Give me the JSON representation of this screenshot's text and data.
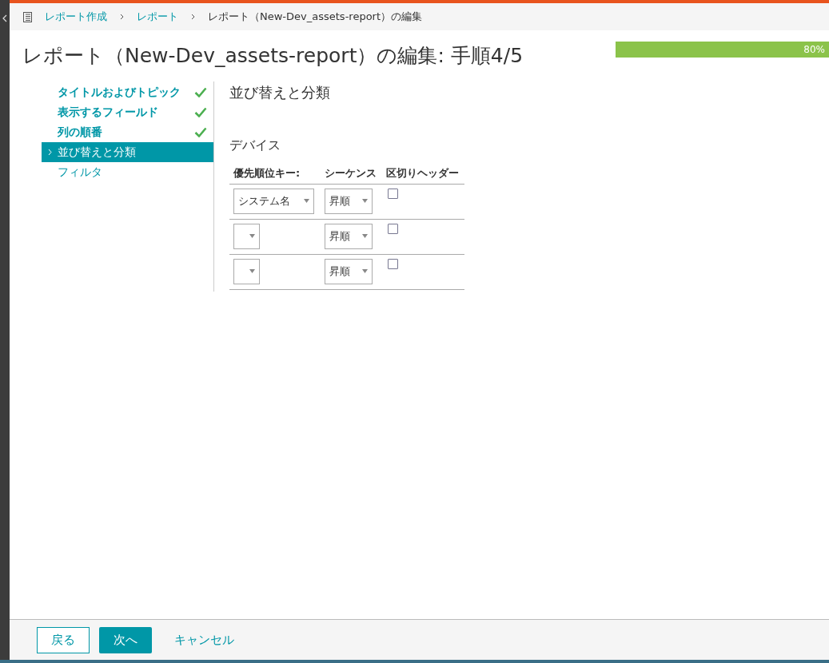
{
  "breadcrumb": [
    {
      "label": "レポート作成",
      "link": true
    },
    {
      "label": "レポート",
      "link": true
    },
    {
      "label": "レポート（New-Dev_assets-report）の編集",
      "link": false
    }
  ],
  "title": "レポート（New-Dev_assets-report）の編集: 手順4/5",
  "progress": {
    "level": 1,
    "reading": "80%"
  },
  "steps": [
    {
      "label": "タイトルおよびトピック",
      "done": true,
      "selected": false
    },
    {
      "label": "表示するフィールド",
      "done": true,
      "selected": false
    },
    {
      "label": "列の順番",
      "done": true,
      "selected": false
    },
    {
      "label": "並び替えと分類",
      "done": false,
      "selected": true
    },
    {
      "label": "フィルタ",
      "done": false,
      "selected": false
    }
  ],
  "section_title": "並び替えと分類",
  "group_title": "デバイス",
  "table": {
    "columns": [
      "優先順位キー:",
      "シーケンス",
      "区切りヘッダー"
    ],
    "rows": [
      {
        "key": "システム名",
        "sequence": "昇順",
        "checked": false
      },
      {
        "sequence": "昇順",
        "checked": false
      },
      {
        "sequence": "昇順",
        "checked": false
      }
    ]
  },
  "buttons": {
    "back": "戻る",
    "next": "次へ",
    "cancel": "キャンセル"
  }
}
